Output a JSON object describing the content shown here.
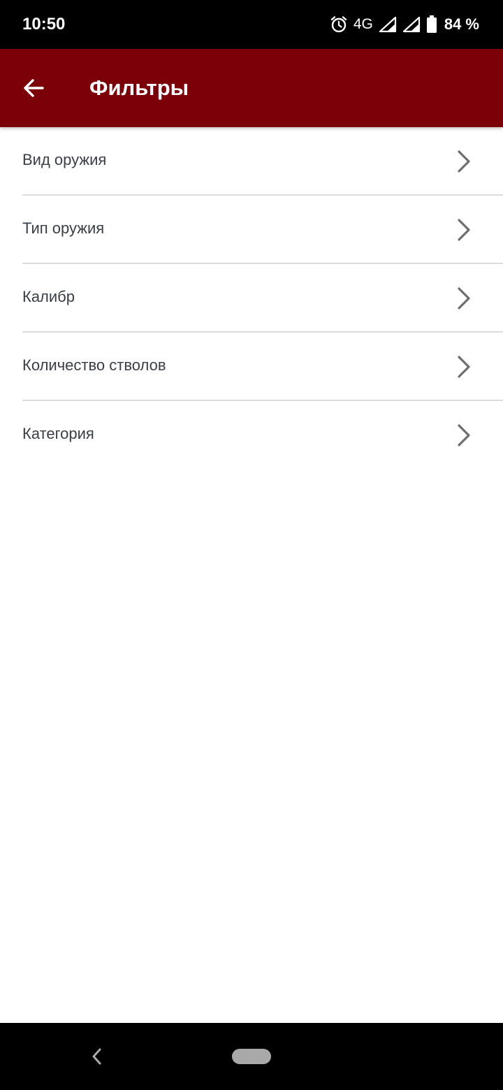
{
  "status_bar": {
    "time": "10:50",
    "network": "4G",
    "battery": "84 %",
    "icons": [
      "alarm-icon",
      "signal-icon",
      "signal-icon",
      "battery-icon"
    ]
  },
  "app_bar": {
    "title": "Фильтры",
    "back_icon": "arrow-left-icon",
    "background_color": "#7b0007"
  },
  "filters": [
    {
      "label": "Вид оружия",
      "icon": "chevron-right-icon"
    },
    {
      "label": "Тип оружия",
      "icon": "chevron-right-icon"
    },
    {
      "label": "Калибр",
      "icon": "chevron-right-icon"
    },
    {
      "label": "Количество стволов",
      "icon": "chevron-right-icon"
    },
    {
      "label": "Категория",
      "icon": "chevron-right-icon"
    }
  ],
  "nav_bar": {
    "back_icon": "nav-back-icon",
    "home_icon": "nav-home-pill"
  }
}
